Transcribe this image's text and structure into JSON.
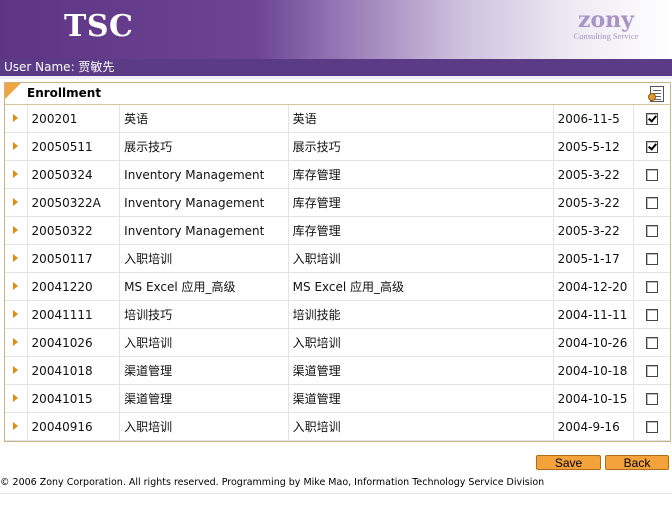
{
  "header": {
    "brand": "TSC",
    "logo_main": "zony",
    "logo_sub": "Consulting Service"
  },
  "user": {
    "label": "User Name: 贾敏先"
  },
  "panel": {
    "title": "Enrollment",
    "icon": "note-pad-icon"
  },
  "rows": [
    {
      "code": "200201",
      "name": "英语",
      "name_cn": "英语",
      "date": "2006-11-5",
      "checked": true
    },
    {
      "code": "20050511",
      "name": "展示技巧",
      "name_cn": "展示技巧",
      "date": "2005-5-12",
      "checked": true
    },
    {
      "code": "20050324",
      "name": "Inventory Management",
      "name_cn": "库存管理",
      "date": "2005-3-22",
      "checked": false
    },
    {
      "code": "20050322A",
      "name": "Inventory Management",
      "name_cn": "库存管理",
      "date": "2005-3-22",
      "checked": false
    },
    {
      "code": "20050322",
      "name": "Inventory Management",
      "name_cn": "库存管理",
      "date": "2005-3-22",
      "checked": false
    },
    {
      "code": "20050117",
      "name": "入职培训",
      "name_cn": "入职培训",
      "date": "2005-1-17",
      "checked": false
    },
    {
      "code": "20041220",
      "name": "MS Excel 应用_高级",
      "name_cn": "MS Excel 应用_高级",
      "date": "2004-12-20",
      "checked": false
    },
    {
      "code": "20041111",
      "name": "培训技巧",
      "name_cn": "培训技能",
      "date": "2004-11-11",
      "checked": false
    },
    {
      "code": "20041026",
      "name": "入职培训",
      "name_cn": "入职培训",
      "date": "2004-10-26",
      "checked": false
    },
    {
      "code": "20041018",
      "name": "渠道管理",
      "name_cn": "渠道管理",
      "date": "2004-10-18",
      "checked": false
    },
    {
      "code": "20041015",
      "name": "渠道管理",
      "name_cn": "渠道管理",
      "date": "2004-10-15",
      "checked": false
    },
    {
      "code": "20040916",
      "name": "入职培训",
      "name_cn": "入职培训",
      "date": "2004-9-16",
      "checked": false
    }
  ],
  "buttons": {
    "save": "Save",
    "back": "Back"
  },
  "footer": {
    "text": "© 2006  Zony Corporation.  All rights reserved. Programming by Mike Mao, Information Technology Service Division"
  },
  "colors": {
    "header_purple": "#5e3585",
    "userbar": "#5b3a86",
    "accent_orange": "#f4a23c"
  }
}
